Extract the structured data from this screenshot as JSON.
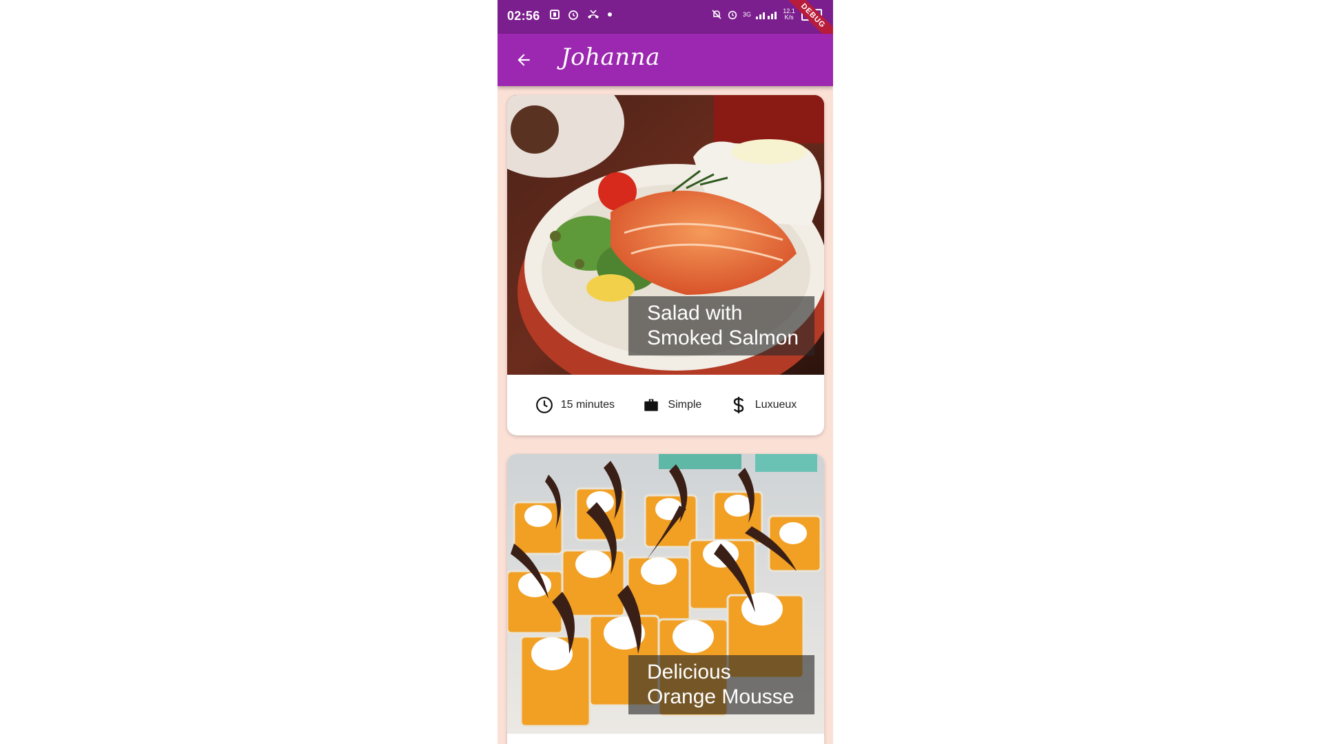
{
  "status_bar": {
    "time": "02:56",
    "signal_label": "3G",
    "speed_label": "12.1 K/s",
    "battery_level": "39",
    "debug_label": "DEBUG"
  },
  "app_bar": {
    "title": "Johanna",
    "back_icon": "arrow-left-icon",
    "background_color": "#9c27b0"
  },
  "recipes": [
    {
      "title": "Salad with Smoked Salmon",
      "duration": "15 minutes",
      "complexity": "Simple",
      "affordability": "Luxueux"
    },
    {
      "title": "Delicious Orange Mousse"
    }
  ],
  "colors": {
    "status_bar": "#7b1f8e",
    "page_background": "#fbe0d6",
    "accent": "#9c27b0"
  }
}
